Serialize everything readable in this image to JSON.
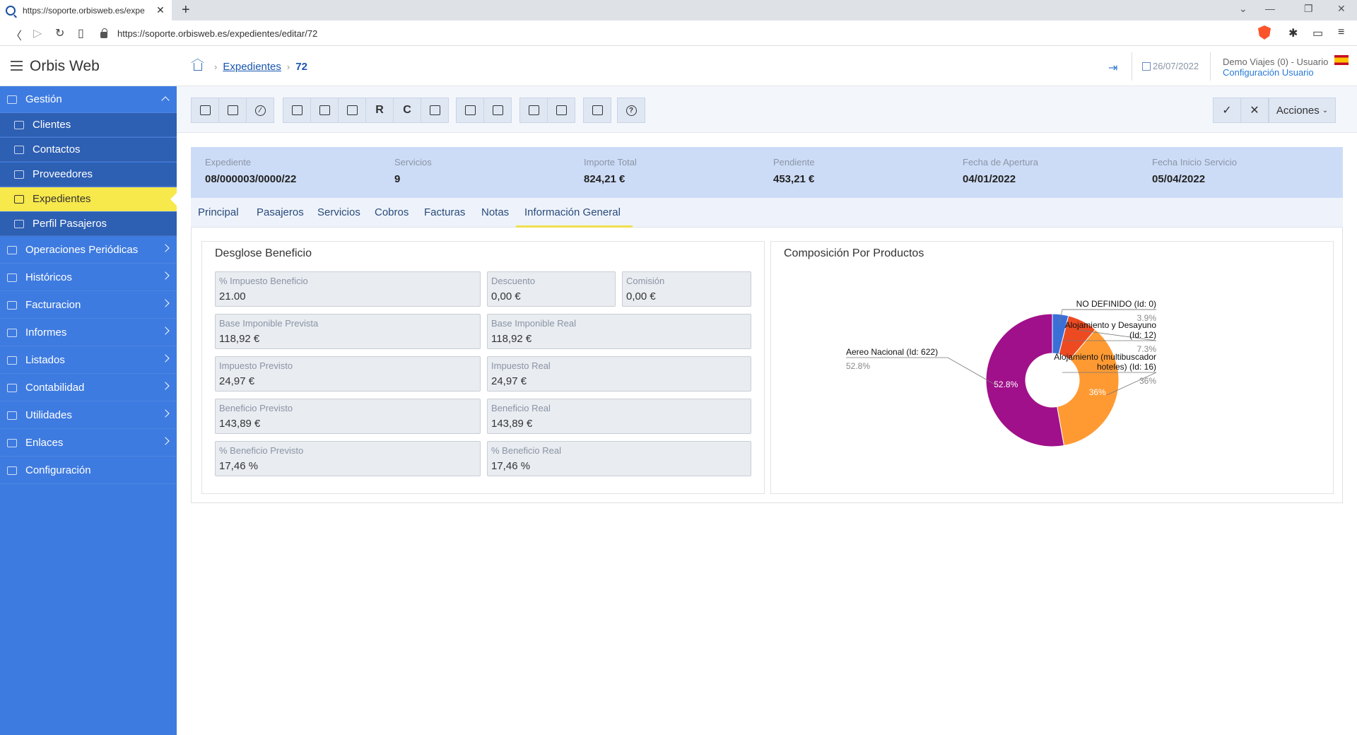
{
  "browser": {
    "tab_title": "https://soporte.orbisweb.es/expe",
    "url": "https://soporte.orbisweb.es/expedientes/editar/72"
  },
  "header": {
    "app_title": "Orbis Web",
    "breadcrumb": {
      "section": "Expedientes",
      "current": "72"
    },
    "date": "26/07/2022",
    "user_name": "Demo Viajes (0) - Usuario",
    "user_config": "Configuración Usuario"
  },
  "sidebar": {
    "gestion": "Gestión",
    "sub_items": [
      "Clientes",
      "Contactos",
      "Proveedores",
      "Expedientes",
      "Perfil Pasajeros"
    ],
    "items": [
      "Operaciones Periódicas",
      "Históricos",
      "Facturacion",
      "Informes",
      "Listados",
      "Contabilidad",
      "Utilidades",
      "Enlaces",
      "Configuración"
    ]
  },
  "toolbar": {
    "r_label": "R",
    "c_label": "C",
    "acciones": "Acciones"
  },
  "summary": [
    {
      "label": "Expediente",
      "value": "08/000003/0000/22"
    },
    {
      "label": "Servicios",
      "value": "9"
    },
    {
      "label": "Importe Total",
      "value": "824,21 €"
    },
    {
      "label": "Pendiente",
      "value": "453,21 €"
    },
    {
      "label": "Fecha de Apertura",
      "value": "04/01/2022"
    },
    {
      "label": "Fecha Inicio Servicio",
      "value": "05/04/2022"
    }
  ],
  "tabs": [
    "Principal",
    "Pasajeros",
    "Servicios",
    "Cobros",
    "Facturas",
    "Notas",
    "Información General"
  ],
  "desglose": {
    "title": "Desglose Beneficio",
    "fields": [
      {
        "label": "% Impuesto Beneficio",
        "value": "21.00"
      },
      {
        "label": "Descuento",
        "value": "0,00 €"
      },
      {
        "label": "Comisión",
        "value": "0,00 €"
      },
      {
        "label": "Base Imponible Prevista",
        "value": "118,92 €"
      },
      {
        "label": "Base Imponible Real",
        "value": "118,92 €"
      },
      {
        "label": "Impuesto Previsto",
        "value": "24,97 €"
      },
      {
        "label": "Impuesto Real",
        "value": "24,97 €"
      },
      {
        "label": "Beneficio Previsto",
        "value": "143,89 €"
      },
      {
        "label": "Beneficio Real",
        "value": "143,89 €"
      },
      {
        "label": "% Beneficio Previsto",
        "value": "17,46 %"
      },
      {
        "label": "% Beneficio Real",
        "value": "17,46 %"
      }
    ]
  },
  "composicion": {
    "title": "Composición Por Productos"
  },
  "chart_data": {
    "type": "pie",
    "donut": true,
    "slices": [
      {
        "name": "NO DEFINIDO (Id: 0)",
        "value": 3.9,
        "pct_label": "3.9%",
        "color": "#3a6fd8"
      },
      {
        "name": "Alojamiento y Desayuno (Id: 12)",
        "value": 7.3,
        "pct_label": "7.3%",
        "color": "#ee4a22"
      },
      {
        "name": "Alojamiento (multibuscador hoteles) (Id: 16)",
        "value": 36,
        "pct_label": "36%",
        "color": "#ff9a33"
      },
      {
        "name": "Aereo Nacional (Id: 622)",
        "value": 52.8,
        "pct_label": "52.8%",
        "color": "#a0108a"
      }
    ],
    "inner_labels": [
      "36%",
      "52.8%"
    ]
  }
}
